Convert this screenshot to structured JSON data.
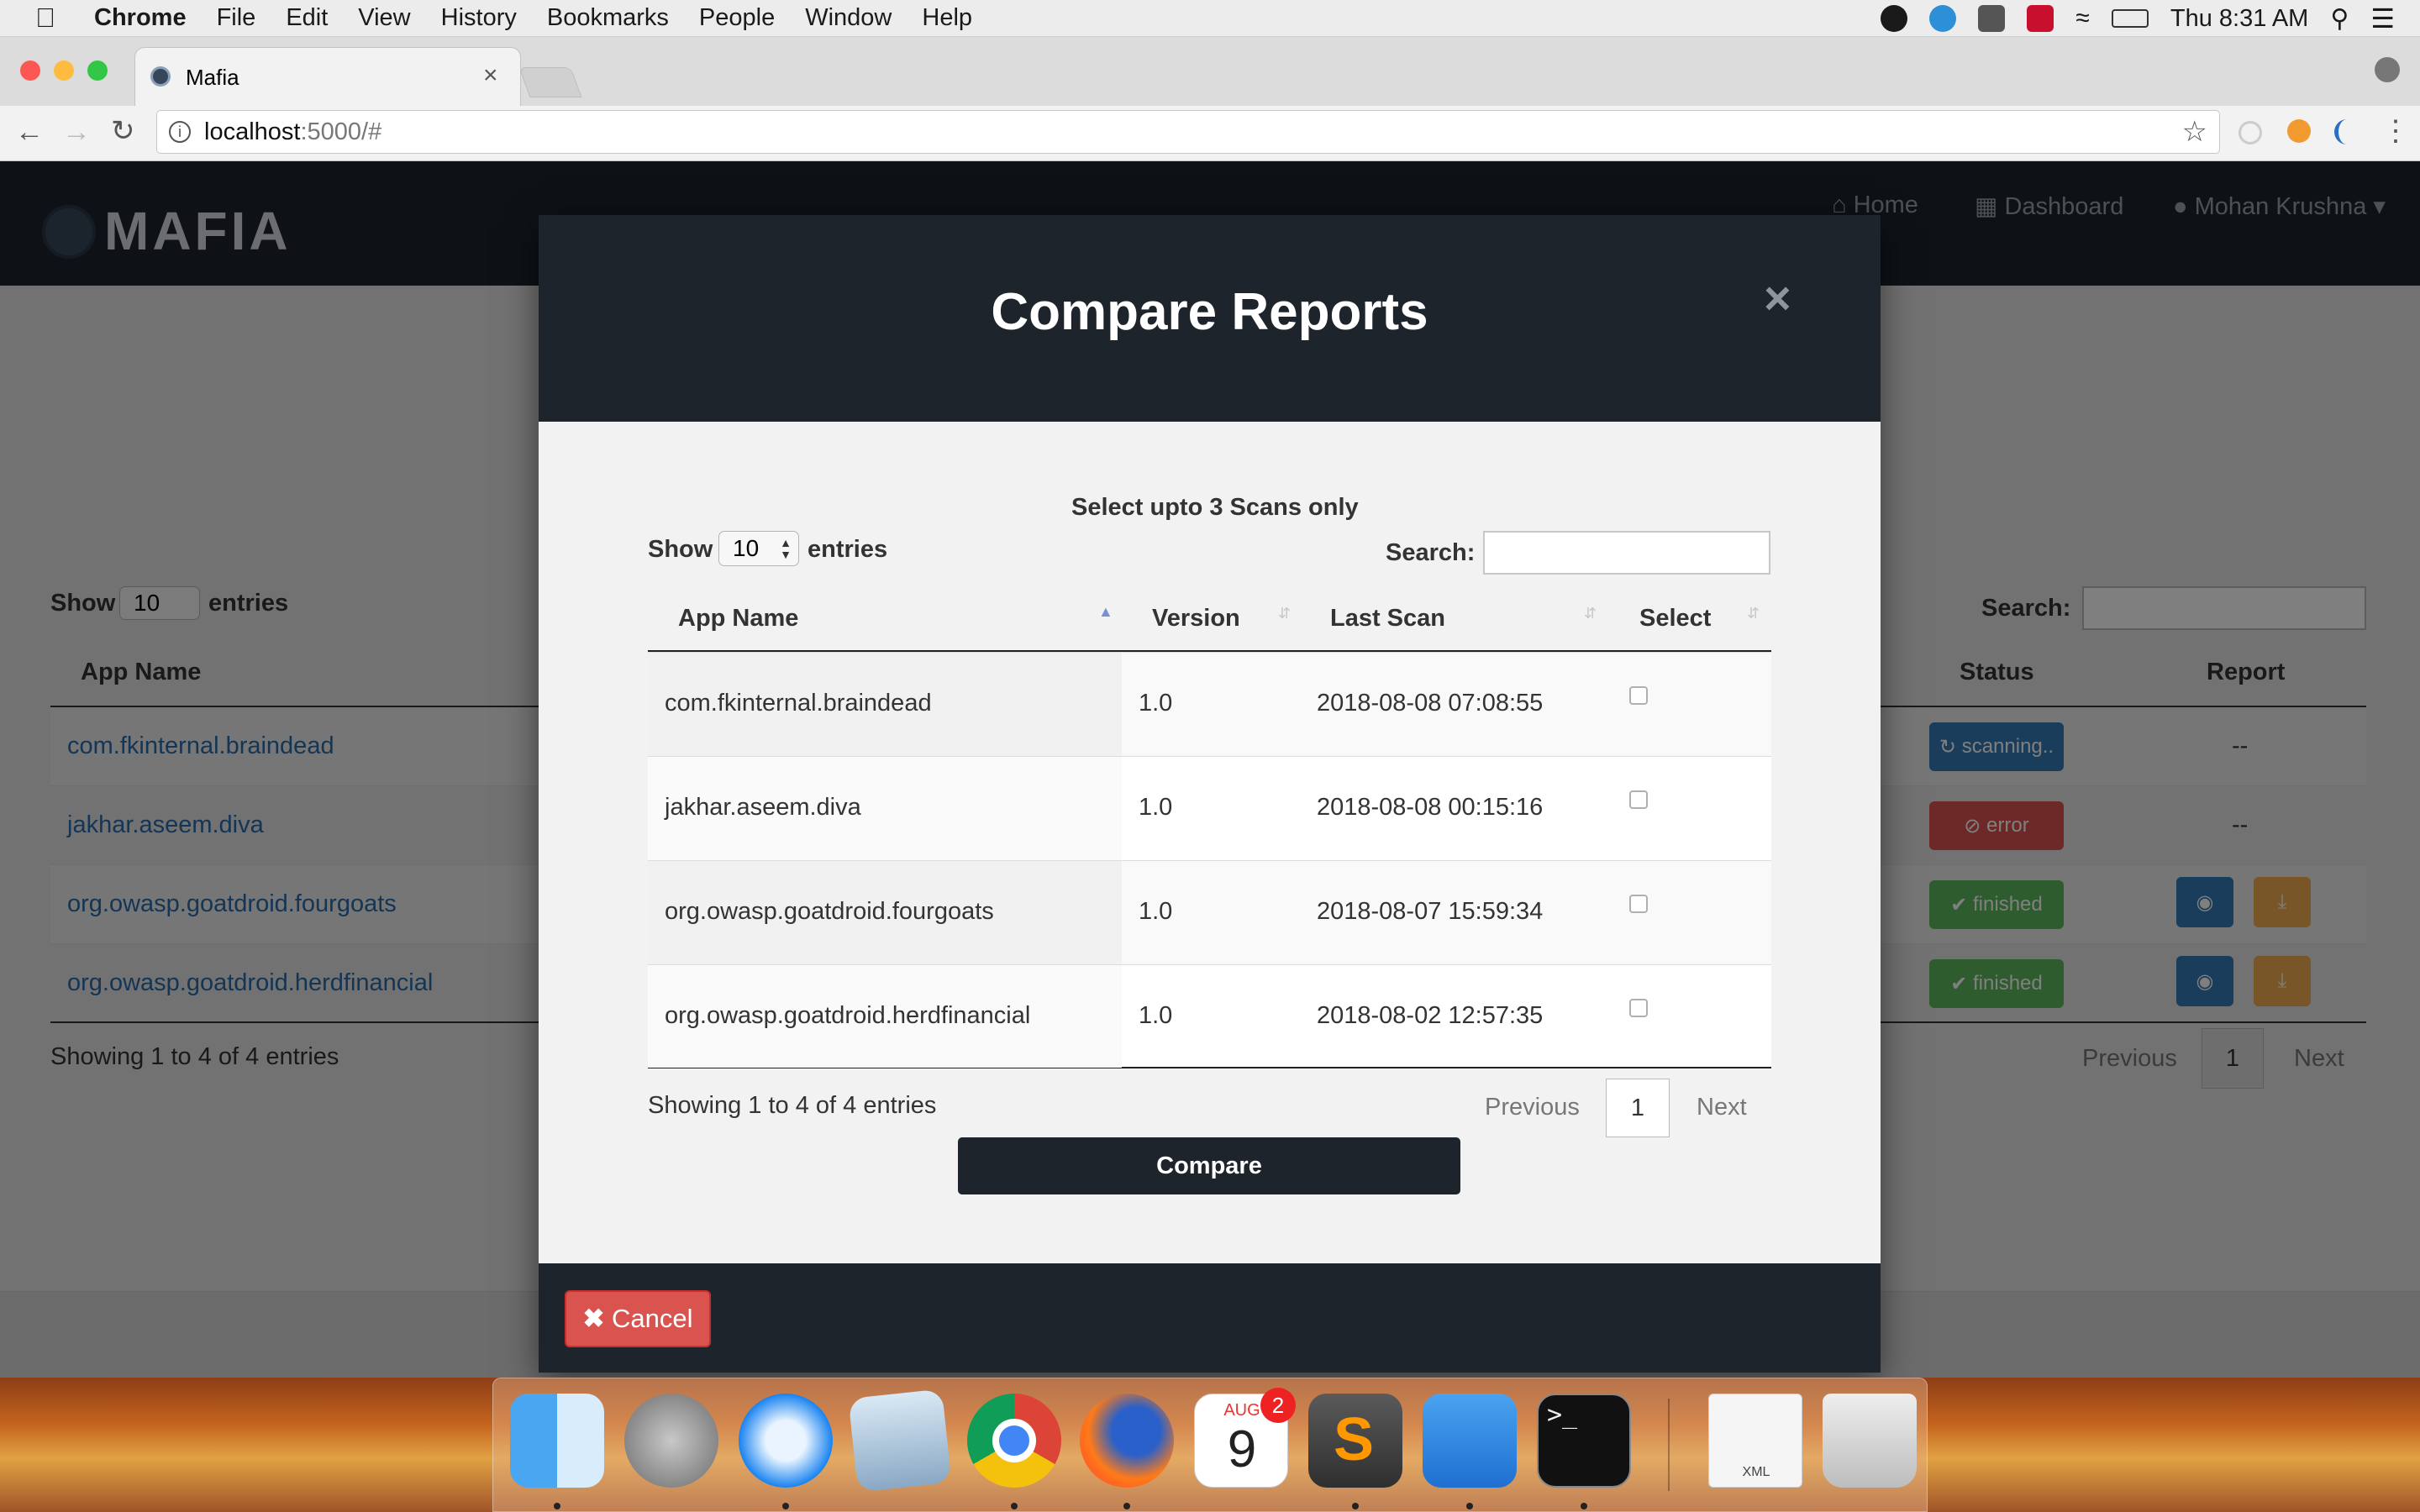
{
  "menubar": {
    "app": "Chrome",
    "items": [
      "File",
      "Edit",
      "View",
      "History",
      "Bookmarks",
      "People",
      "Window",
      "Help"
    ],
    "clock": "Thu 8:31 AM"
  },
  "browser": {
    "tab_title": "Mafia",
    "url_host": "localhost",
    "url_rest": ":5000/#"
  },
  "app": {
    "logo_text": "MAFIA",
    "nav": {
      "home": "Home",
      "dashboard": "Dashboard",
      "user": "Mohan Krushna"
    }
  },
  "background_table": {
    "show_label": "Show",
    "entries_value": "10",
    "entries_label": "entries",
    "search_label": "Search:",
    "headers": {
      "app_name": "App Name",
      "status": "Status",
      "report": "Report"
    },
    "rows": [
      {
        "app": "com.fkinternal.braindead",
        "status": "scanning..",
        "report": "--"
      },
      {
        "app": "jakhar.aseem.diva",
        "status": "error",
        "report": "--"
      },
      {
        "app": "org.owasp.goatdroid.fourgoats",
        "status": "finished",
        "report": ""
      },
      {
        "app": "org.owasp.goatdroid.herdfinancial",
        "status": "finished",
        "report": ""
      }
    ],
    "info": "Showing 1 to 4 of 4 entries",
    "pagination": {
      "previous": "Previous",
      "page": "1",
      "next": "Next"
    }
  },
  "modal": {
    "title": "Compare Reports",
    "close": "×",
    "instruction": "Select upto 3 Scans only",
    "show_label": "Show",
    "entries_value": "10",
    "entries_label": "entries",
    "search_label": "Search:",
    "headers": {
      "app_name": "App Name",
      "version": "Version",
      "last_scan": "Last Scan",
      "select": "Select"
    },
    "rows": [
      {
        "app": "com.fkinternal.braindead",
        "version": "1.0",
        "last_scan": "2018-08-08 07:08:55"
      },
      {
        "app": "jakhar.aseem.diva",
        "version": "1.0",
        "last_scan": "2018-08-08 00:15:16"
      },
      {
        "app": "org.owasp.goatdroid.fourgoats",
        "version": "1.0",
        "last_scan": "2018-08-07 15:59:34"
      },
      {
        "app": "org.owasp.goatdroid.herdfinancial",
        "version": "1.0",
        "last_scan": "2018-08-02 12:57:35"
      }
    ],
    "info": "Showing 1 to 4 of 4 entries",
    "pagination": {
      "previous": "Previous",
      "page": "1",
      "next": "Next"
    },
    "compare_label": "Compare",
    "cancel_label": "Cancel"
  },
  "dock": {
    "calendar_month": "AUG",
    "calendar_day": "9",
    "calendar_badge": "2",
    "file_label": "XML"
  }
}
